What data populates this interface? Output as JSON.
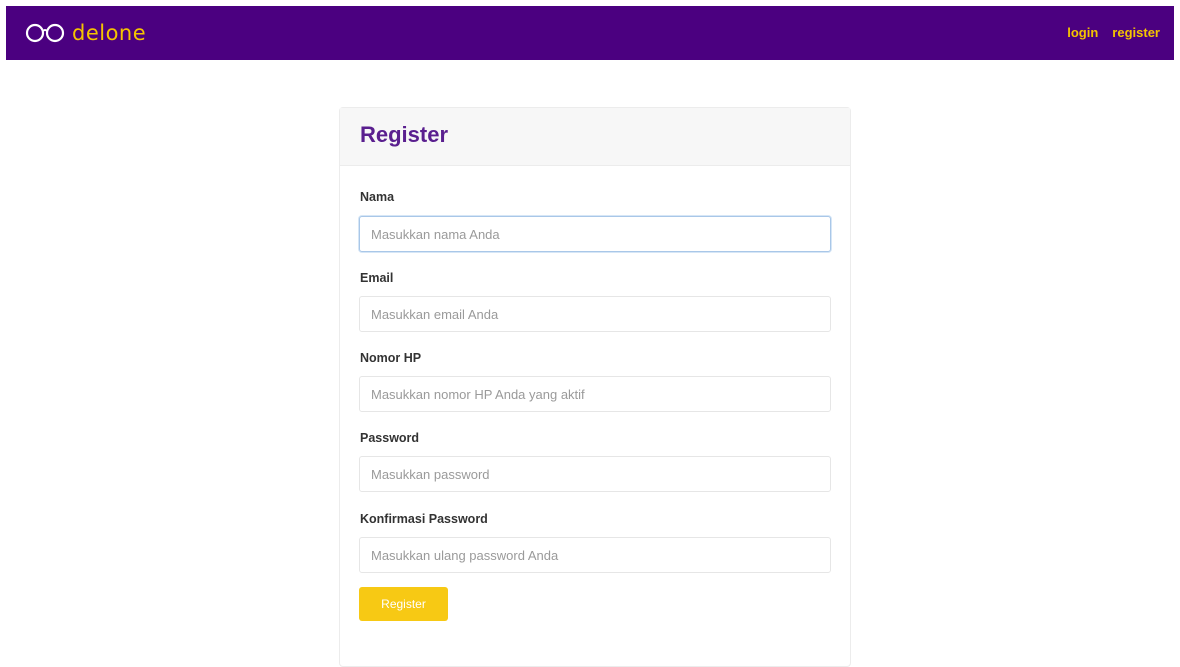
{
  "navbar": {
    "brand_text": "delone",
    "links": [
      {
        "label": "login"
      },
      {
        "label": "register"
      }
    ]
  },
  "form": {
    "title": "Register",
    "fields": [
      {
        "label": "Nama",
        "placeholder": "Masukkan nama Anda",
        "value": "",
        "focused": true
      },
      {
        "label": "Email",
        "placeholder": "Masukkan email Anda",
        "value": ""
      },
      {
        "label": "Nomor HP",
        "placeholder": "Masukkan nomor HP Anda yang aktif",
        "value": ""
      },
      {
        "label": "Password",
        "placeholder": "Masukkan password",
        "value": ""
      },
      {
        "label": "Konfirmasi Password",
        "placeholder": "Masukkan ulang password Anda",
        "value": ""
      }
    ],
    "submit_label": "Register"
  },
  "colors": {
    "navbar_bg": "#4b0080",
    "accent": "#f5c400",
    "title": "#5a1f8f",
    "button": "#f7c914"
  },
  "icons": {
    "brand": "glasses-icon"
  }
}
